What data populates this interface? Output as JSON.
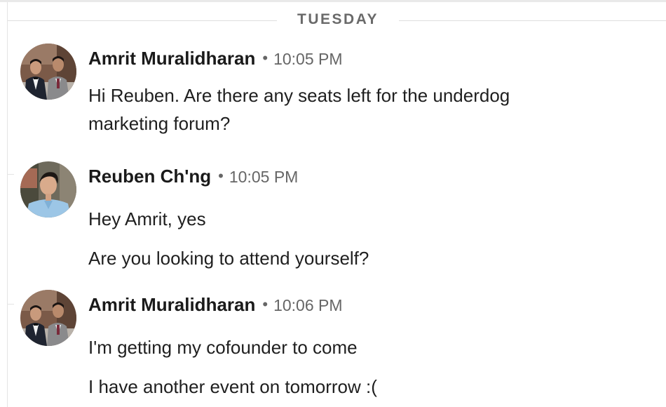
{
  "day_divider": {
    "label": "TUESDAY"
  },
  "messages": [
    {
      "sender": "Amrit Muralidharan",
      "separator": "•",
      "time": "10:05 PM",
      "avatar": "two-men-in-suits-photo",
      "lines": [
        "Hi Reuben. Are there any seats left for the underdog",
        "marketing forum?"
      ]
    },
    {
      "sender": "Reuben Ch'ng",
      "separator": "•",
      "time": "10:05 PM",
      "avatar": "man-in-light-blue-shirt-photo",
      "lines": [
        "Hey Amrit, yes",
        "Are you looking to attend yourself?"
      ]
    },
    {
      "sender": "Amrit Muralidharan",
      "separator": "•",
      "time": "10:06 PM",
      "avatar": "two-men-in-suits-photo",
      "lines": [
        "I'm getting my cofounder to come",
        "I have another event on tomorrow :("
      ]
    }
  ]
}
